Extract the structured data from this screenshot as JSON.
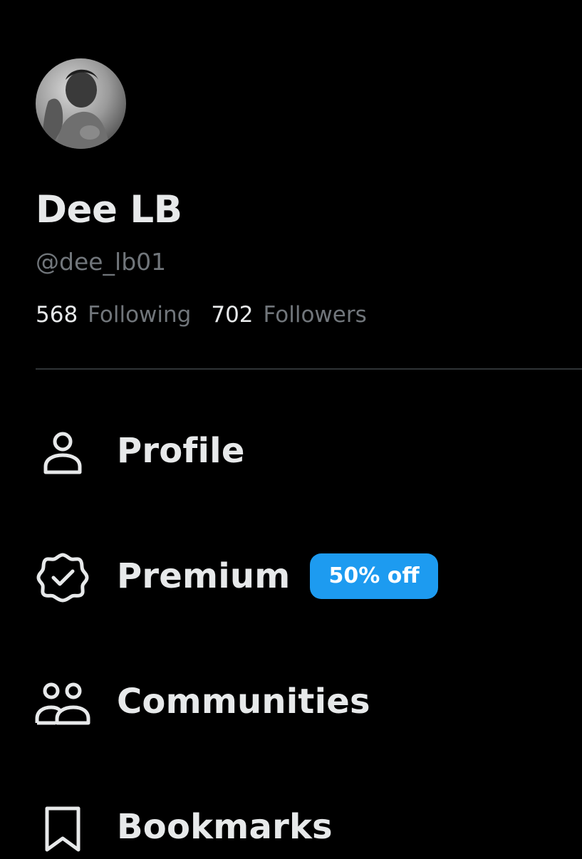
{
  "profile": {
    "display_name": "Dee LB",
    "handle": "@dee_lb01",
    "following_count": "568",
    "following_label": "Following",
    "followers_count": "702",
    "followers_label": "Followers"
  },
  "nav": {
    "items": [
      {
        "label": "Profile",
        "icon": "person-icon"
      },
      {
        "label": "Premium",
        "icon": "verified-badge-icon",
        "badge": "50% off"
      },
      {
        "label": "Communities",
        "icon": "people-icon"
      },
      {
        "label": "Bookmarks",
        "icon": "bookmark-icon"
      }
    ]
  },
  "colors": {
    "background": "#000000",
    "primary_text": "#e7e9ea",
    "secondary_text": "#71767b",
    "divider": "#2f3336",
    "accent": "#1d9bf0"
  }
}
